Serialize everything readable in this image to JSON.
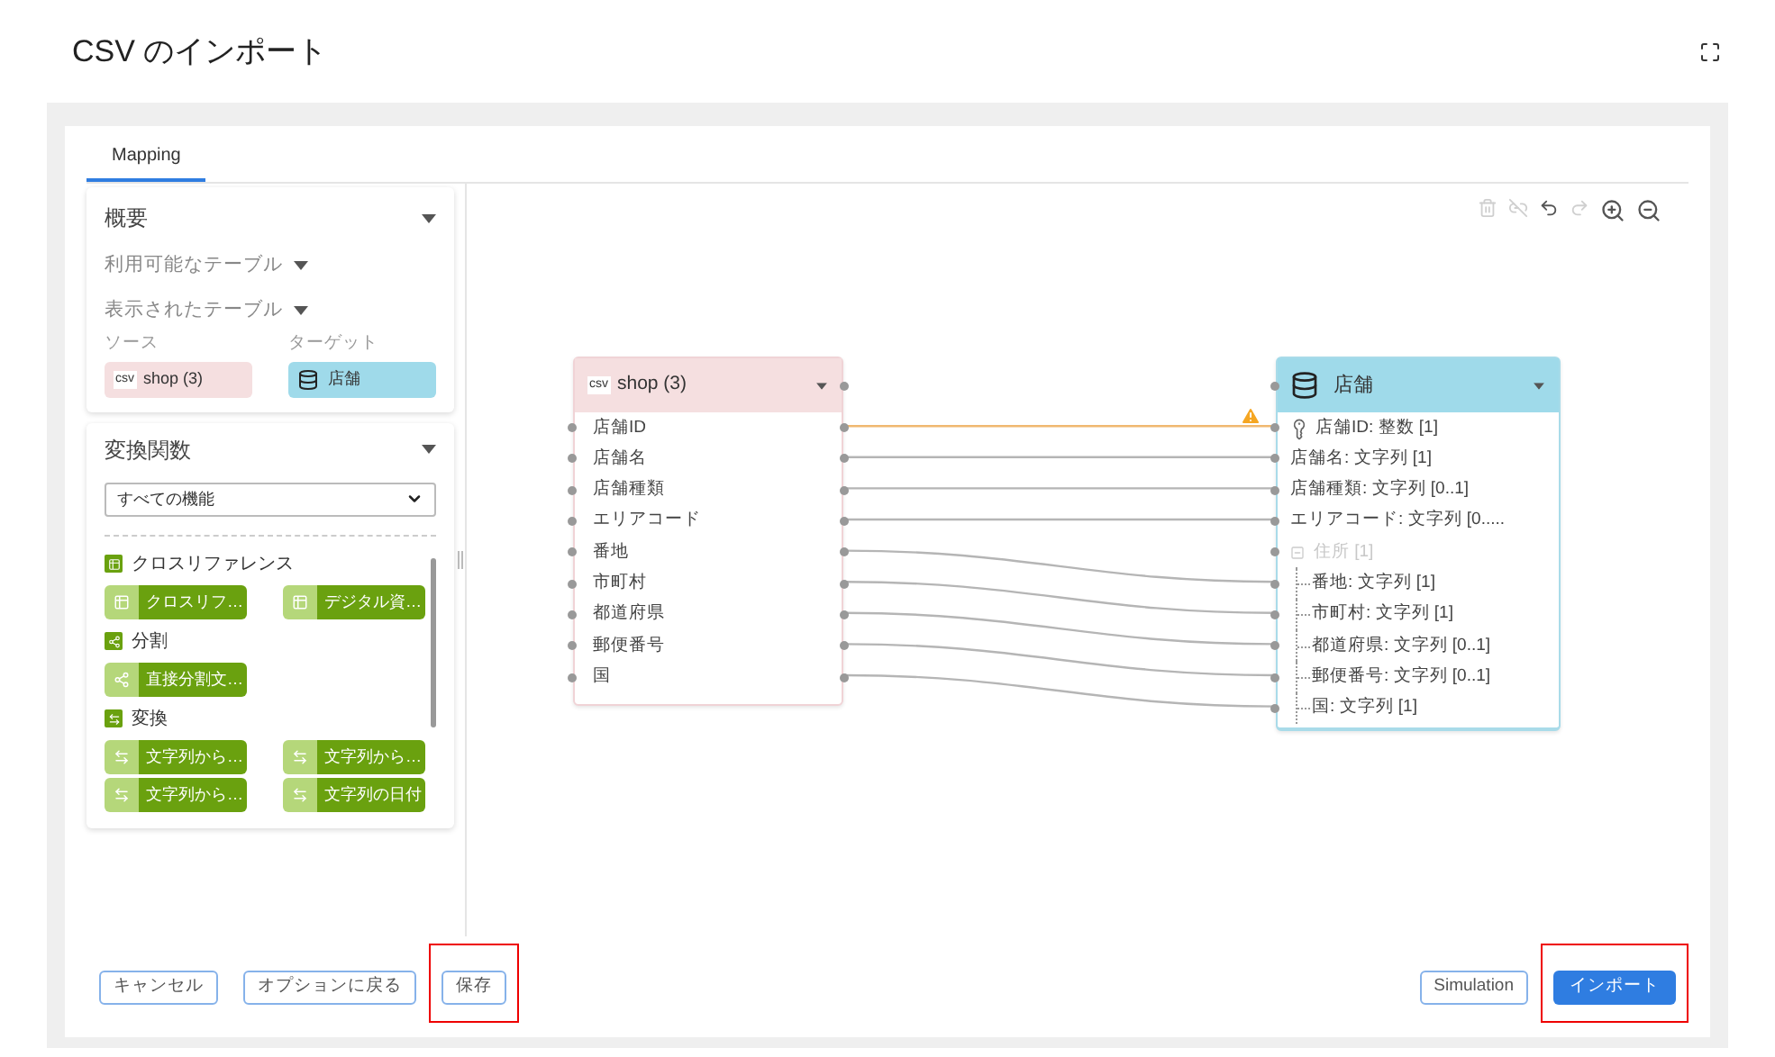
{
  "title": "CSV のインポート",
  "tabs": [
    {
      "label": "Mapping",
      "selected": true
    }
  ],
  "overview": {
    "title": "概要",
    "expanded": true,
    "available_tables": "利用可能なテーブル",
    "shown_tables": "表示されたテーブル",
    "source_label": "ソース",
    "target_label": "ターゲット",
    "source": {
      "badge": "csv",
      "name": "shop (3)"
    },
    "target": {
      "name": "店舗"
    }
  },
  "functions": {
    "title": "変換関数",
    "expanded": true,
    "filter": "すべての機能",
    "categories": [
      {
        "kind": "xref",
        "name": "クロスリファレンス",
        "items": [
          "クロスリフ…",
          "デジタル資…"
        ]
      },
      {
        "kind": "split",
        "name": "分割",
        "items": [
          "直接分割文…"
        ]
      },
      {
        "kind": "convert",
        "name": "変換",
        "items": [
          "文字列から…",
          "文字列から…",
          "文字列から…",
          "文字列の日付"
        ]
      }
    ]
  },
  "toolbar": [
    {
      "kind": "delete",
      "disabled": true
    },
    {
      "kind": "unlink",
      "disabled": true
    },
    {
      "kind": "undo",
      "disabled": false
    },
    {
      "kind": "redo",
      "disabled": true
    },
    {
      "kind": "zoom_in",
      "disabled": false
    },
    {
      "kind": "zoom_out",
      "disabled": false
    }
  ],
  "source_node": {
    "badge": "csv",
    "name": "shop (3)",
    "fields": [
      {
        "label": "店舗ID",
        "warning": true
      },
      {
        "label": "店舗名",
        "warning": false
      },
      {
        "label": "店舗種類",
        "warning": false
      },
      {
        "label": "エリアコード",
        "warning": false
      },
      {
        "label": "番地",
        "warning": false
      },
      {
        "label": "市町村",
        "warning": false
      },
      {
        "label": "都道府県",
        "warning": false
      },
      {
        "label": "郵便番号",
        "warning": false
      },
      {
        "label": "国",
        "warning": false
      }
    ]
  },
  "target_node": {
    "name": "店舗",
    "fields": [
      {
        "kind": "key",
        "label": "店舗ID: 整数 [1]"
      },
      {
        "kind": "field",
        "label": "店舗名: 文字列 [1]"
      },
      {
        "kind": "field",
        "label": "店舗種類: 文字列 [0..1]"
      },
      {
        "kind": "field",
        "label": "エリアコード: 文字列 [0....."
      },
      {
        "kind": "group",
        "label": "住所 [1]",
        "disabled": true,
        "children": [
          {
            "kind": "field",
            "label": "番地: 文字列 [1]"
          },
          {
            "kind": "field",
            "label": "市町村: 文字列 [1]"
          },
          {
            "kind": "field",
            "label": "都道府県: 文字列 [0..1]"
          },
          {
            "kind": "field",
            "label": "郵便番号: 文字列 [0..1]"
          },
          {
            "kind": "field",
            "label": "国: 文字列 [1]"
          }
        ]
      }
    ]
  },
  "footer_left": [
    {
      "label": "キャンセル",
      "kind": "outline",
      "highlighted": false
    },
    {
      "label": "オプションに戻る",
      "kind": "outline",
      "highlighted": false
    },
    {
      "label": "保存",
      "kind": "outline",
      "highlighted": true
    }
  ],
  "footer_right": [
    {
      "label": "Simulation",
      "kind": "outline",
      "highlighted": false
    },
    {
      "label": "インポート",
      "kind": "primary",
      "highlighted": true
    }
  ]
}
